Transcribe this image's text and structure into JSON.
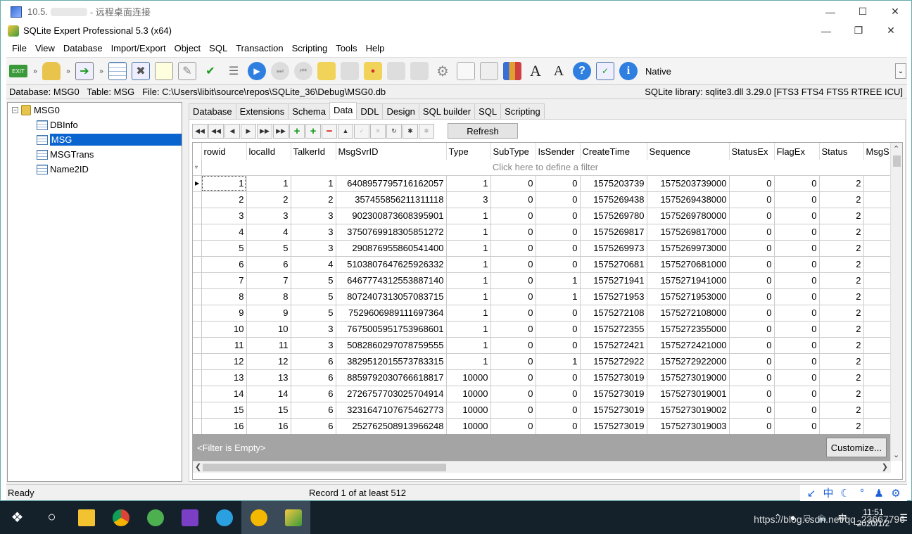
{
  "rdp": {
    "title_prefix": "10.5.",
    "title_suffix": "- 远程桌面连接"
  },
  "app": {
    "title": "SQLite Expert Professional 5.3 (x64)"
  },
  "menu": [
    "File",
    "View",
    "Database",
    "Import/Export",
    "Object",
    "SQL",
    "Transaction",
    "Scripting",
    "Tools",
    "Help"
  ],
  "toolbar": {
    "exit_label": "EXIT",
    "native_label": "Native",
    "icons": [
      "open-database-icon",
      "attach-database-icon",
      "import-icon",
      "new-table-icon",
      "edit-table-icon",
      "new-view-icon",
      "edit-view-icon",
      "new-index-icon",
      "edit-index-icon",
      "run-icon",
      "run-step-icon",
      "stop-icon",
      "script-icon",
      "script-run-icon",
      "script-stop-icon",
      "script-save-icon",
      "script-open-icon",
      "settings-icon",
      "copy-icon",
      "paste-icon",
      "report-icon",
      "font-increase-icon",
      "font-decrease-icon",
      "help-icon",
      "update-icon",
      "info-icon"
    ]
  },
  "infobar": {
    "left": "Database: MSG0   Table: MSG   File: C:\\Users\\libit\\source\\repos\\SQLite_36\\Debug\\MSG0.db",
    "right": "SQLite library: sqlite3.dll 3.29.0 [FTS3 FTS4 FTS5 RTREE ICU]"
  },
  "tree": {
    "db": "MSG0",
    "tables": [
      "DBInfo",
      "MSG",
      "MSGTrans",
      "Name2ID"
    ],
    "selected": "MSG"
  },
  "tabs": [
    "Database",
    "Extensions",
    "Schema",
    "Data",
    "DDL",
    "Design",
    "SQL builder",
    "SQL",
    "Scripting"
  ],
  "active_tab": "Data",
  "nav": {
    "refresh_label": "Refresh"
  },
  "grid": {
    "columns": [
      "rowid",
      "localId",
      "TalkerId",
      "MsgSvrID",
      "Type",
      "SubType",
      "IsSender",
      "CreateTime",
      "Sequence",
      "StatusEx",
      "FlagEx",
      "Status",
      "MsgS"
    ],
    "filter_hint": "Click here to define a filter",
    "rows": [
      [
        "1",
        "1",
        "1",
        "6408957795716162057",
        "1",
        "0",
        "0",
        "1575203739",
        "1575203739000",
        "0",
        "0",
        "2"
      ],
      [
        "2",
        "2",
        "2",
        "357455856211311118",
        "3",
        "0",
        "0",
        "1575269438",
        "1575269438000",
        "0",
        "0",
        "2"
      ],
      [
        "3",
        "3",
        "3",
        "902300873608395901",
        "1",
        "0",
        "0",
        "1575269780",
        "1575269780000",
        "0",
        "0",
        "2"
      ],
      [
        "4",
        "4",
        "3",
        "3750769918305851272",
        "1",
        "0",
        "0",
        "1575269817",
        "1575269817000",
        "0",
        "0",
        "2"
      ],
      [
        "5",
        "5",
        "3",
        "290876955860541400",
        "1",
        "0",
        "0",
        "1575269973",
        "1575269973000",
        "0",
        "0",
        "2"
      ],
      [
        "6",
        "6",
        "4",
        "5103807647625926332",
        "1",
        "0",
        "0",
        "1575270681",
        "1575270681000",
        "0",
        "0",
        "2"
      ],
      [
        "7",
        "7",
        "5",
        "6467774312553887140",
        "1",
        "0",
        "1",
        "1575271941",
        "1575271941000",
        "0",
        "0",
        "2"
      ],
      [
        "8",
        "8",
        "5",
        "8072407313057083715",
        "1",
        "0",
        "1",
        "1575271953",
        "1575271953000",
        "0",
        "0",
        "2"
      ],
      [
        "9",
        "9",
        "5",
        "7529606989111697364",
        "1",
        "0",
        "0",
        "1575272108",
        "1575272108000",
        "0",
        "0",
        "2"
      ],
      [
        "10",
        "10",
        "3",
        "7675005951753968601",
        "1",
        "0",
        "0",
        "1575272355",
        "1575272355000",
        "0",
        "0",
        "2"
      ],
      [
        "11",
        "11",
        "3",
        "5082860297078759555",
        "1",
        "0",
        "0",
        "1575272421",
        "1575272421000",
        "0",
        "0",
        "2"
      ],
      [
        "12",
        "12",
        "6",
        "3829512015573783315",
        "1",
        "0",
        "1",
        "1575272922",
        "1575272922000",
        "0",
        "0",
        "2"
      ],
      [
        "13",
        "13",
        "6",
        "8859792030766618817",
        "10000",
        "0",
        "0",
        "1575273019",
        "1575273019000",
        "0",
        "0",
        "2"
      ],
      [
        "14",
        "14",
        "6",
        "2726757703025704914",
        "10000",
        "0",
        "0",
        "1575273019",
        "1575273019001",
        "0",
        "0",
        "2"
      ],
      [
        "15",
        "15",
        "6",
        "3231647107675462773",
        "10000",
        "0",
        "0",
        "1575273019",
        "1575273019002",
        "0",
        "0",
        "2"
      ],
      [
        "16",
        "16",
        "6",
        "2527625089139662​48",
        "10000",
        "0",
        "0",
        "1575273019",
        "1575273019003",
        "0",
        "0",
        "2"
      ]
    ],
    "filter_empty": "<Filter is Empty>",
    "customize_label": "Customize..."
  },
  "status": {
    "ready": "Ready",
    "record": "Record 1 of at least 512"
  },
  "ime": [
    "中"
  ],
  "tray": {
    "time": "11:51",
    "date": "2020/1/2",
    "watermark": "https://blog.csdn.net/qq_23667796",
    "ime_char": "中"
  }
}
